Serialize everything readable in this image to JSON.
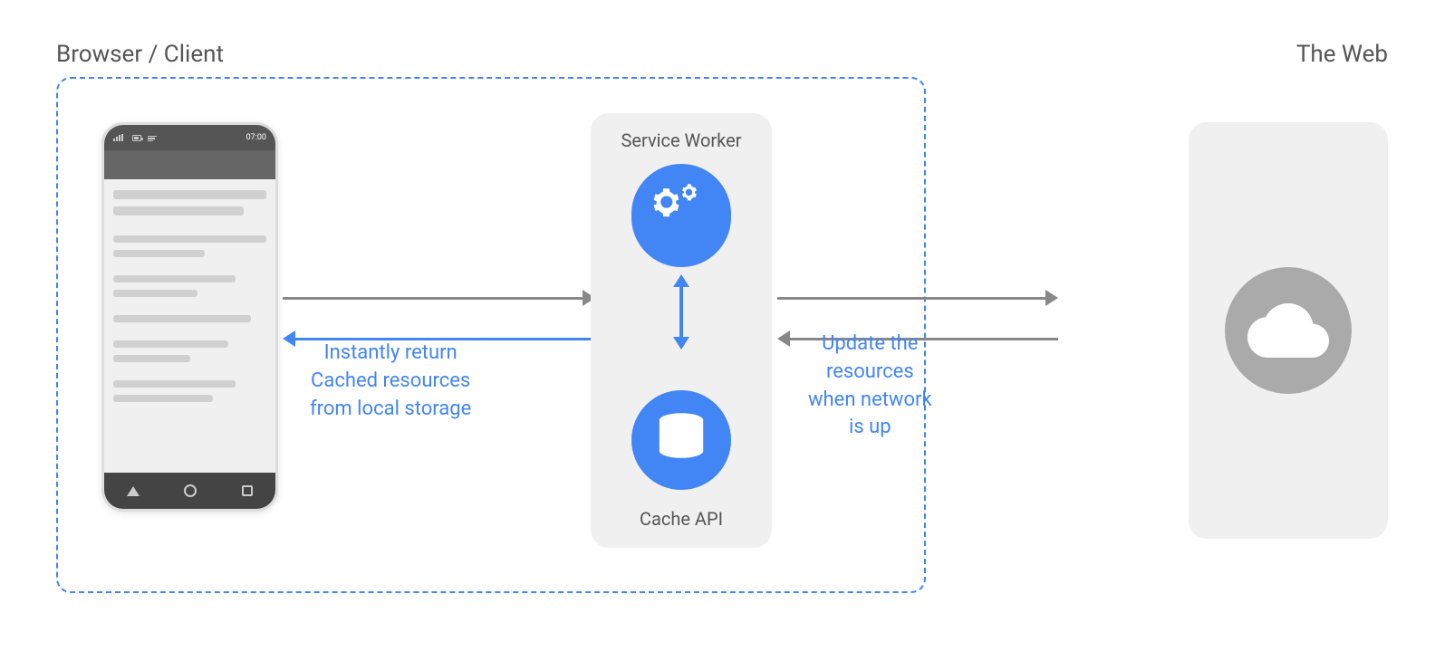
{
  "labels": {
    "browser_client": "Browser / Client",
    "the_web": "The Web",
    "service_worker": "Service Worker",
    "cache_api": "Cache API",
    "instantly_return": "Instantly return",
    "cached_resources": "Cached resources",
    "from_local_storage": "from local storage",
    "update_the": "Update the",
    "resources": "resources",
    "when_network": "when network",
    "is_up": "is up"
  },
  "colors": {
    "blue": "#4285f4",
    "gray_arrow": "#888888",
    "box_bg": "#f0f0f0",
    "phone_dark": "#555555",
    "phone_light": "#d0d0d0",
    "cloud_gray": "#aaaaaa"
  }
}
